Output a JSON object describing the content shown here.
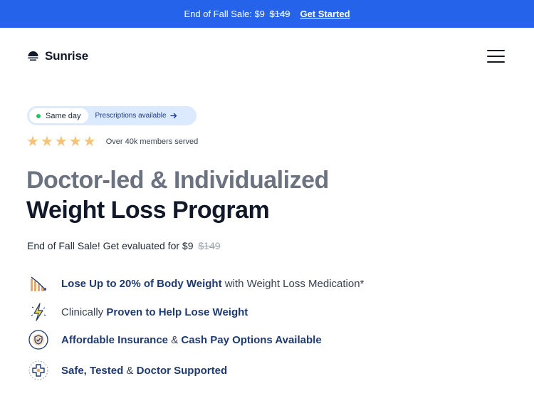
{
  "promo": {
    "text": "End of Fall Sale: $9",
    "old_price": "$149",
    "cta": "Get Started"
  },
  "header": {
    "brand": "Sunrise",
    "menu_icon": "hamburger-menu-icon"
  },
  "badge": {
    "tag": "Same day",
    "link": "Prescriptions available",
    "arrow_icon": "arrow-right-icon"
  },
  "rating": {
    "stars": 5,
    "text": "Over 40k members served",
    "star_color": "#f4c37a"
  },
  "hero": {
    "line1": "Doctor-led & Individualized",
    "line2": "Weight Loss Program"
  },
  "sale": {
    "text": "End of Fall Sale! Get evaluated for $9",
    "old_price": "$149"
  },
  "features": [
    {
      "icon": "weight-loss-chart-icon",
      "parts": [
        [
          "b",
          "Lose Up to 20% of Body Weight"
        ],
        [
          "t",
          " with Weight Loss Medication*"
        ]
      ]
    },
    {
      "icon": "lightning-bolt-icon",
      "parts": [
        [
          "t",
          "Clinically "
        ],
        [
          "b",
          "Proven to Help Lose Weight"
        ]
      ]
    },
    {
      "icon": "insurance-shield-icon",
      "parts": [
        [
          "b",
          "Affordable Insurance"
        ],
        [
          "t",
          " & "
        ],
        [
          "b",
          "Cash Pay Options Available"
        ]
      ]
    },
    {
      "icon": "medical-cross-icon",
      "parts": [
        [
          "b",
          "Safe, Tested"
        ],
        [
          "t",
          " & "
        ],
        [
          "b",
          "Doctor Supported"
        ]
      ]
    }
  ],
  "colors": {
    "promo_bg": "#2563eb",
    "accent_navy": "#1e3a6f",
    "hero_grey": "#6b7280"
  }
}
